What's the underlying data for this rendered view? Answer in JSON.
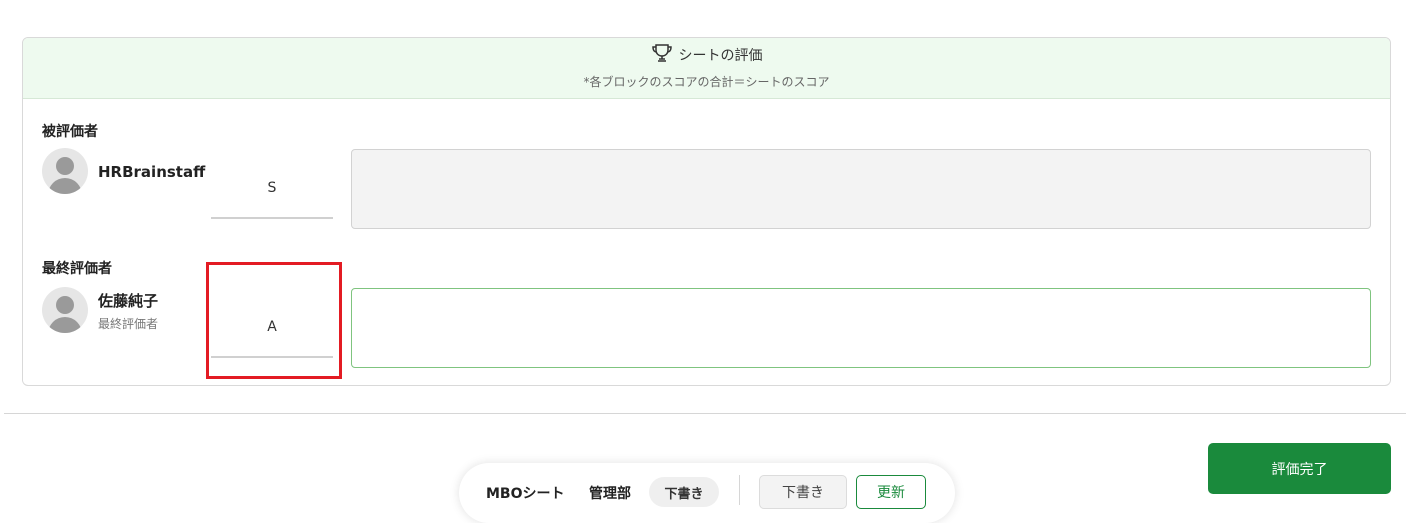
{
  "evaluation_card": {
    "title": "シートの評価",
    "subtitle": "*各ブロックのスコアの合計＝シートのスコア",
    "icon": "trophy-icon"
  },
  "evaluatee": {
    "section_label": "被評価者",
    "name": "HRBrainstaff",
    "grade": "S",
    "comment": ""
  },
  "final_evaluator": {
    "section_label": "最終評価者",
    "name": "佐藤純子",
    "role": "最終評価者",
    "grade": "A",
    "comment": ""
  },
  "actions": {
    "complete_label": "評価完了"
  },
  "status_bar": {
    "sheet_name": "MBOシート",
    "department": "管理部",
    "status_badge": "下書き",
    "draft_button": "下書き",
    "update_button": "更新"
  },
  "colors": {
    "accent_green": "#1a8a3c",
    "header_bg": "#eefaef",
    "highlight_red": "#e31b23"
  }
}
